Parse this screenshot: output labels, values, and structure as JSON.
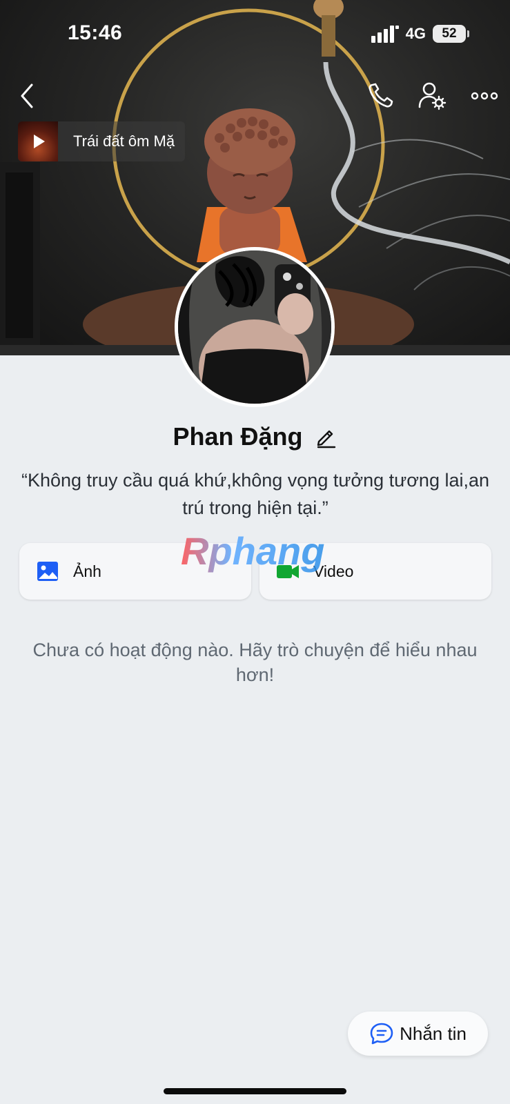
{
  "status_bar": {
    "time": "15:46",
    "network": "4G",
    "battery": "52"
  },
  "header": {
    "back_icon": "chevron-left-icon",
    "call_icon": "phone-icon",
    "profile_settings_icon": "user-gear-icon",
    "more_icon": "more-horizontal-icon"
  },
  "music": {
    "title": "Trái đất ôm Mặ",
    "icon": "play-icon"
  },
  "profile": {
    "name": "Phan Đặng",
    "bio": "“Không truy cầu quá khứ,không vọng tưởng tương lai,an trú trong hiện tại.”"
  },
  "media_cards": [
    {
      "label": "Ảnh",
      "icon": "image-icon",
      "color": "#1e5ff5"
    },
    {
      "label": "Video",
      "icon": "video-camera-icon",
      "color": "#11a632"
    }
  ],
  "watermark": "Rphang",
  "empty_state": "Chưa có hoạt động nào. Hãy trò chuyện để hiểu nhau hơn!",
  "message_button": {
    "label": "Nhắn tin",
    "icon": "chat-bubble-icon"
  },
  "colors": {
    "page_background": "#ebeef1",
    "accent_blue": "#1e5ff5",
    "video_green": "#11a632"
  }
}
